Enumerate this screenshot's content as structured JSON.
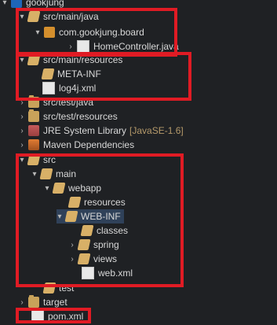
{
  "tree": {
    "project": "gookjung",
    "items": {
      "src_main_java": "src/main/java",
      "pkg_board": "com.gookjung.board",
      "home_controller": "HomeController.java",
      "src_main_resources": "src/main/resources",
      "meta_inf": "META-INF",
      "log4j": "log4j.xml",
      "src_test_java": "src/test/java",
      "src_test_resources": "src/test/resources",
      "jre_library": "JRE System Library",
      "jre_version": "[JavaSE-1.6]",
      "maven_deps": "Maven Dependencies",
      "src": "src",
      "main": "main",
      "webapp": "webapp",
      "resources": "resources",
      "web_inf": "WEB-INF",
      "classes": "classes",
      "spring": "spring",
      "views": "views",
      "web_xml": "web.xml",
      "test": "test",
      "target": "target",
      "pom": "pom.xml"
    }
  },
  "colors": {
    "background": "#1f2124",
    "highlight_box": "#e01b24",
    "selection": "#2f4159"
  },
  "icons": {
    "folder": "folder-icon",
    "package": "package-icon",
    "java_file": "java-file-icon",
    "xml_file": "xml-file-icon",
    "library": "library-icon",
    "maven": "maven-icon",
    "project": "project-icon"
  }
}
